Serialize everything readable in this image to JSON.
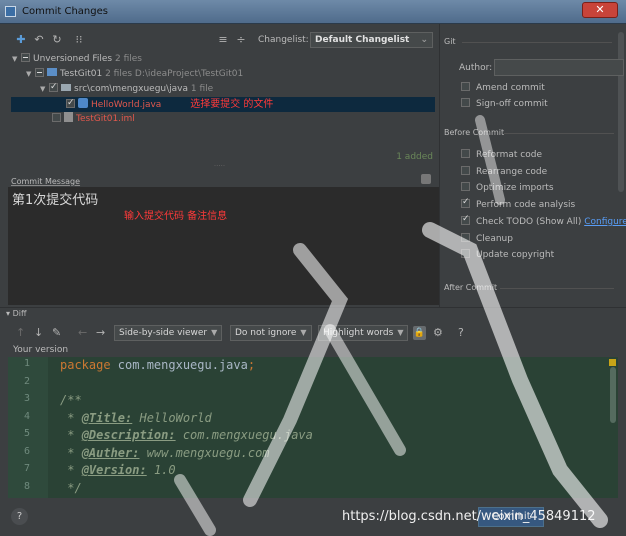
{
  "window": {
    "title": "Commit Changes",
    "close_symbol": "✕"
  },
  "toolbar": {
    "icons": [
      "refresh-icon",
      "undo-icon",
      "sync-icon",
      "group-icon",
      "expand-icon",
      "collapse-icon"
    ],
    "changelist_label": "Changelist:",
    "changelist_value": "Default Changelist"
  },
  "tree": {
    "root": {
      "label": "Unversioned Files",
      "count": "2 files"
    },
    "module": {
      "label": "TestGit01",
      "count": "2 files",
      "path": "D:\\ideaProject\\TestGit01"
    },
    "package": {
      "label": "src\\com\\mengxuegu\\java",
      "count": "1 file"
    },
    "file1": "HelloWorld.java",
    "file1_note": "选择要提交  的文件",
    "file2": "TestGit01.iml"
  },
  "added_text": "1 added",
  "commit_message": {
    "label": "Commit Message",
    "value": "第1次提交代码",
    "note": "输入提交代码  备注信息"
  },
  "git": {
    "section": "Git",
    "author_label": "Author:",
    "amend": "Amend commit",
    "signoff": "Sign-off commit"
  },
  "before_commit": {
    "section": "Before Commit",
    "options": [
      {
        "label": "Reformat code",
        "checked": false
      },
      {
        "label": "Rearrange code",
        "checked": false
      },
      {
        "label": "Optimize imports",
        "checked": false
      },
      {
        "label": "Perform code analysis",
        "checked": true
      },
      {
        "label": "Check TODO (Show All)",
        "checked": true,
        "link": "Configure"
      },
      {
        "label": "Cleanup",
        "checked": false
      },
      {
        "label": "Update copyright",
        "checked": false
      }
    ]
  },
  "after_commit": {
    "section": "After Commit"
  },
  "diff": {
    "label": "Diff",
    "viewer": "Side-by-side viewer",
    "ignore": "Do not ignore",
    "highlight": "Highlight words",
    "help": "?",
    "your_version": "Your version"
  },
  "code_lines": [
    {
      "n": "1",
      "parts": [
        [
          "kw",
          "package "
        ],
        [
          "pkg",
          "com.mengxuegu.java"
        ],
        [
          "kw",
          ";"
        ]
      ]
    },
    {
      "n": "2",
      "parts": []
    },
    {
      "n": "3",
      "parts": [
        [
          "cmt",
          "/**"
        ]
      ]
    },
    {
      "n": "4",
      "parts": [
        [
          "cmt",
          " * "
        ],
        [
          "tag",
          "@Title:"
        ],
        [
          "cmt",
          " HelloWorld"
        ]
      ]
    },
    {
      "n": "5",
      "parts": [
        [
          "cmt",
          " * "
        ],
        [
          "tag",
          "@Description:"
        ],
        [
          "cmt",
          " com.mengxuegu.java"
        ]
      ]
    },
    {
      "n": "6",
      "parts": [
        [
          "cmt",
          " * "
        ],
        [
          "tag",
          "@Auther:"
        ],
        [
          "cmt",
          " www.mengxuegu.com"
        ]
      ]
    },
    {
      "n": "7",
      "parts": [
        [
          "cmt",
          " * "
        ],
        [
          "tag",
          "@Version:"
        ],
        [
          "cmt",
          " 1.0"
        ]
      ]
    },
    {
      "n": "8",
      "parts": [
        [
          "cmt",
          " */"
        ]
      ]
    }
  ],
  "bottom": {
    "help": "?",
    "commit_label": "Commit",
    "watermark": "https://blog.csdn.net/weixin_45849112"
  },
  "colors": {
    "accent": "#365880",
    "selection": "#0d293e",
    "diff_bg": "#2a4235",
    "unversioned": "#e0584d",
    "annotation": "#ff3a3a"
  }
}
